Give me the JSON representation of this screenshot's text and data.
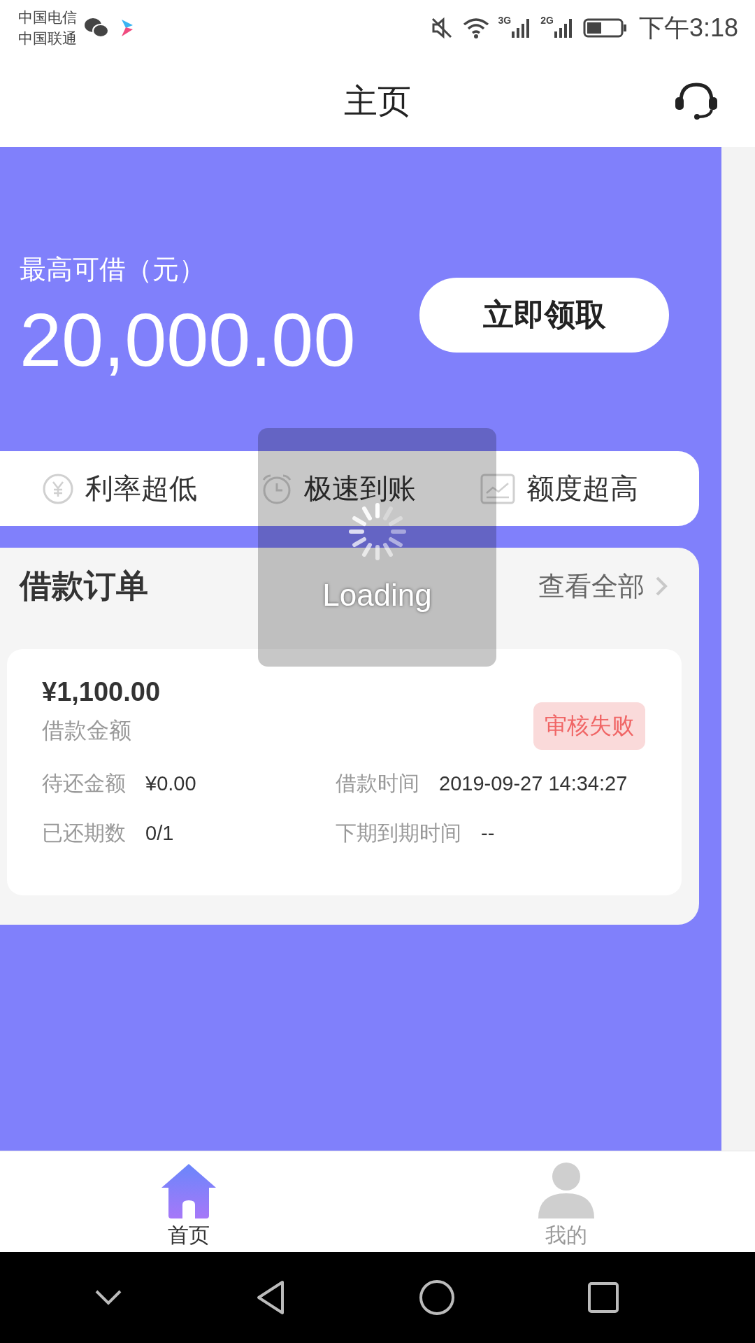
{
  "status_bar": {
    "carriers": [
      "中国电信",
      "中国联通"
    ],
    "network_labels": [
      "3G",
      "2G"
    ],
    "time": "下午3:18"
  },
  "header": {
    "title": "主页"
  },
  "hero": {
    "label": "最高可借（元）",
    "amount": "20,000.00",
    "button": "立即领取"
  },
  "features": [
    {
      "kind": "yuan",
      "label": "利率超低"
    },
    {
      "kind": "clock",
      "label": "极速到账"
    },
    {
      "kind": "chart",
      "label": "额度超高"
    }
  ],
  "orders": {
    "title": "借款订单",
    "view_all": "查看全部",
    "items": [
      {
        "amount": "¥1,100.00",
        "amount_label": "借款金额",
        "status": "审核失败",
        "fields": [
          {
            "label": "待还金额",
            "value": "¥0.00"
          },
          {
            "label": "借款时间",
            "value": "2019-09-27 14:34:27"
          },
          {
            "label": "已还期数",
            "value": "0/1"
          },
          {
            "label": "下期到期时间",
            "value": "--"
          }
        ]
      }
    ]
  },
  "loading": {
    "text": "Loading"
  },
  "tab_bar": [
    {
      "kind": "home",
      "label": "首页",
      "selected": true
    },
    {
      "kind": "user",
      "label": "我的",
      "selected": false
    }
  ]
}
